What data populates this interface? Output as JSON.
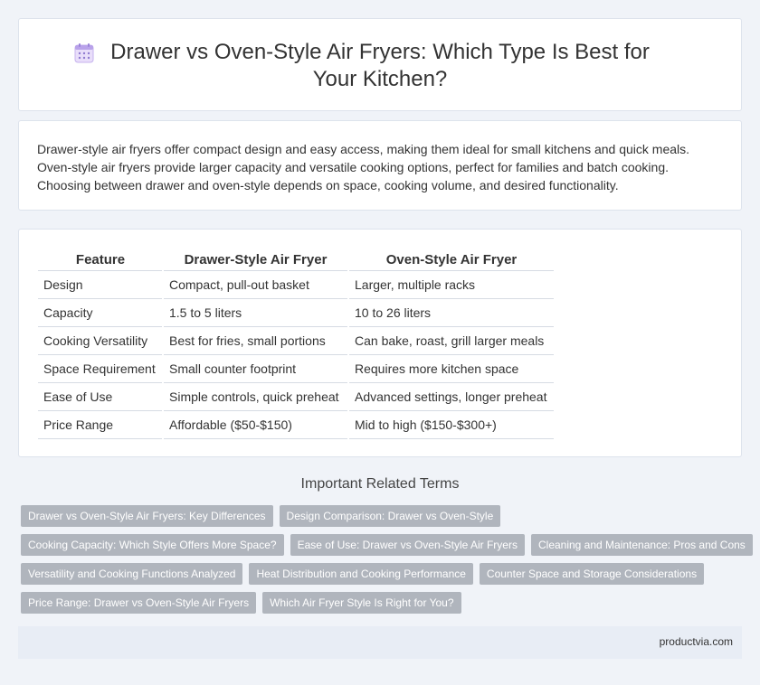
{
  "header": {
    "title": "Drawer vs Oven-Style Air Fryers: Which Type Is Best for Your Kitchen?",
    "icon": "calendar-icon"
  },
  "intro": {
    "text": "Drawer-style air fryers offer compact design and easy access, making them ideal for small kitchens and quick meals. Oven-style air fryers provide larger capacity and versatile cooking options, perfect for families and batch cooking. Choosing between drawer and oven-style depends on space, cooking volume, and desired functionality."
  },
  "table": {
    "headers": [
      "Feature",
      "Drawer-Style Air Fryer",
      "Oven-Style Air Fryer"
    ],
    "rows": [
      [
        "Design",
        "Compact, pull-out basket",
        "Larger, multiple racks"
      ],
      [
        "Capacity",
        "1.5 to 5 liters",
        "10 to 26 liters"
      ],
      [
        "Cooking Versatility",
        "Best for fries, small portions",
        "Can bake, roast, grill larger meals"
      ],
      [
        "Space Requirement",
        "Small counter footprint",
        "Requires more kitchen space"
      ],
      [
        "Ease of Use",
        "Simple controls, quick preheat",
        "Advanced settings, longer preheat"
      ],
      [
        "Price Range",
        "Affordable ($50-$150)",
        "Mid to high ($150-$300+)"
      ]
    ]
  },
  "related": {
    "title": "Important Related Terms",
    "tags": [
      "Drawer vs Oven-Style Air Fryers: Key Differences",
      "Design Comparison: Drawer vs Oven-Style",
      "Cooking Capacity: Which Style Offers More Space?",
      "Ease of Use: Drawer vs Oven-Style Air Fryers",
      "Cleaning and Maintenance: Pros and Cons",
      "Versatility and Cooking Functions Analyzed",
      "Heat Distribution and Cooking Performance",
      "Counter Space and Storage Considerations",
      "Price Range: Drawer vs Oven-Style Air Fryers",
      "Which Air Fryer Style Is Right for You?"
    ]
  },
  "footer": {
    "site": "productvia.com"
  }
}
